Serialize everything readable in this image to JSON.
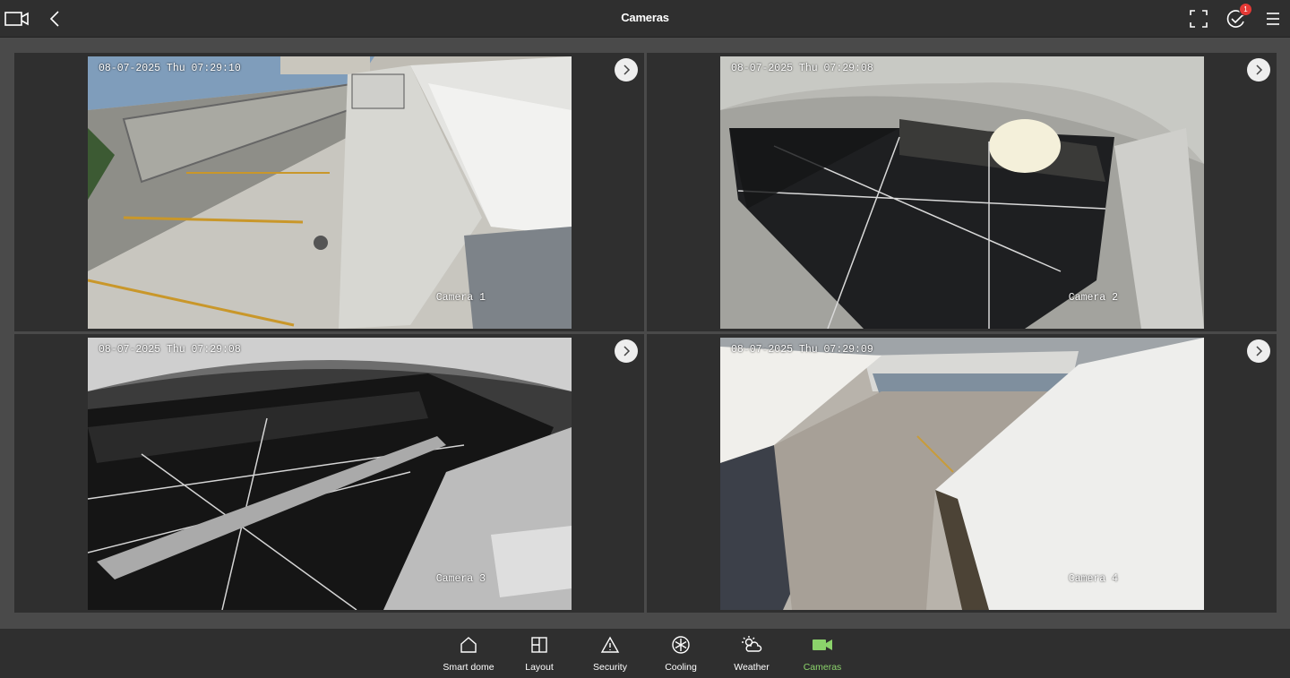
{
  "header": {
    "title": "Cameras",
    "notification_count": "1"
  },
  "cameras": [
    {
      "timestamp": "08-07-2025 Thu 07:29:10",
      "label": "Camera 1"
    },
    {
      "timestamp": "08-07-2025 Thu 07:29:08",
      "label": "Camera 2"
    },
    {
      "timestamp": "08-07-2025 Thu 07:29:08",
      "label": "Camera 3"
    },
    {
      "timestamp": "08-07-2025 Thu 07:29:09",
      "label": "Camera 4"
    }
  ],
  "nav": {
    "items": [
      {
        "label": "Smart dome",
        "icon": "home-icon"
      },
      {
        "label": "Layout",
        "icon": "layout-icon"
      },
      {
        "label": "Security",
        "icon": "warning-icon"
      },
      {
        "label": "Cooling",
        "icon": "snowflake-icon"
      },
      {
        "label": "Weather",
        "icon": "weather-icon"
      },
      {
        "label": "Cameras",
        "icon": "camera-icon"
      }
    ],
    "active": "Cameras",
    "active_color": "#8bd36b"
  }
}
